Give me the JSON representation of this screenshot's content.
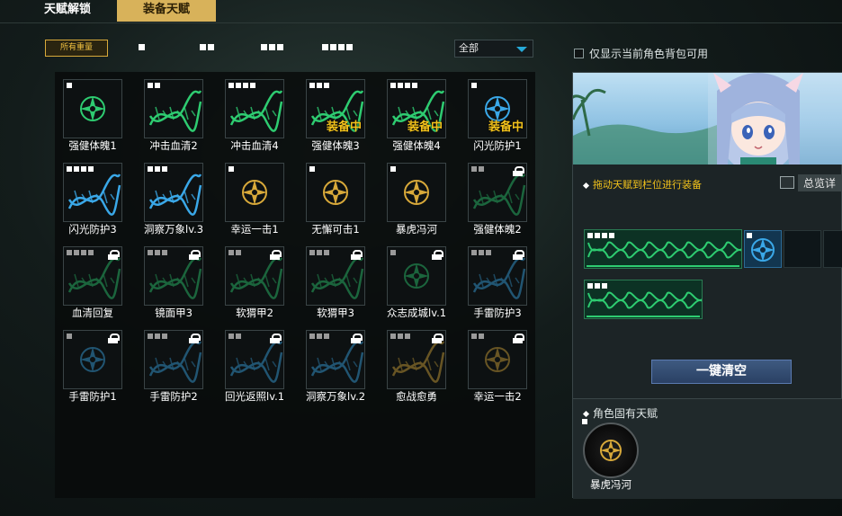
{
  "tabs": {
    "unlock": "天赋解锁",
    "equip": "装备天赋"
  },
  "filter": {
    "all_weight": "所有重量",
    "weight_levels": [
      1,
      2,
      3,
      4
    ],
    "dropdown_value": "全部"
  },
  "show_available_label": "仅显示当前角色背包可用",
  "equipped_text": "装备中",
  "talents": [
    {
      "name": "强健体魄1",
      "pips": 1,
      "locked": false,
      "equipped": false,
      "icon": "gear-badge-icon",
      "color": "#2ecc71"
    },
    {
      "name": "冲击血清2",
      "pips": 2,
      "locked": false,
      "equipped": false,
      "icon": "dna-chain-icon",
      "color": "#2ecc71"
    },
    {
      "name": "冲击血清4",
      "pips": 4,
      "locked": false,
      "equipped": false,
      "icon": "dna-chain-icon",
      "color": "#2ecc71"
    },
    {
      "name": "强健体魄3",
      "pips": 3,
      "locked": false,
      "equipped": true,
      "icon": "dna-chain-icon",
      "color": "#2ecc71"
    },
    {
      "name": "强健体魄4",
      "pips": 4,
      "locked": false,
      "equipped": true,
      "icon": "dna-chain-icon",
      "color": "#2ecc71"
    },
    {
      "name": "闪光防护1",
      "pips": 1,
      "locked": false,
      "equipped": true,
      "icon": "gear-badge-icon",
      "color": "#3aa8e8"
    },
    {
      "name": "闪光防护3",
      "pips": 4,
      "locked": false,
      "equipped": false,
      "icon": "dna-chain-icon",
      "color": "#3aa8e8"
    },
    {
      "name": "洞察万象lv.3",
      "pips": 3,
      "locked": false,
      "equipped": false,
      "icon": "dna-chain-icon",
      "color": "#3aa8e8"
    },
    {
      "name": "幸运一击1",
      "pips": 1,
      "locked": false,
      "equipped": false,
      "icon": "gear-badge-icon",
      "color": "#d8a93a"
    },
    {
      "name": "无懈可击1",
      "pips": 1,
      "locked": false,
      "equipped": false,
      "icon": "gear-badge-icon",
      "color": "#d8a93a"
    },
    {
      "name": "暴虎冯河",
      "pips": 1,
      "locked": false,
      "equipped": false,
      "icon": "gear-badge-icon",
      "color": "#d8a93a"
    },
    {
      "name": "强健体魄2",
      "pips": 2,
      "locked": true,
      "equipped": false,
      "icon": "dna-chain-icon",
      "color": "#2ecc71"
    },
    {
      "name": "血清回复",
      "pips": 4,
      "locked": true,
      "equipped": false,
      "icon": "dna-chain-icon",
      "color": "#2ecc71"
    },
    {
      "name": "镜面甲3",
      "pips": 3,
      "locked": true,
      "equipped": false,
      "icon": "dna-chain-icon",
      "color": "#2ecc71"
    },
    {
      "name": "软猬甲2",
      "pips": 2,
      "locked": true,
      "equipped": false,
      "icon": "dna-chain-icon",
      "color": "#2ecc71"
    },
    {
      "name": "软猬甲3",
      "pips": 3,
      "locked": true,
      "equipped": false,
      "icon": "dna-chain-icon",
      "color": "#2ecc71"
    },
    {
      "name": "众志成城lv.1",
      "pips": 1,
      "locked": true,
      "equipped": false,
      "icon": "gear-badge-icon",
      "color": "#2ecc71"
    },
    {
      "name": "手雷防护3",
      "pips": 3,
      "locked": true,
      "equipped": false,
      "icon": "dna-chain-icon",
      "color": "#3aa8e8"
    },
    {
      "name": "手雷防护1",
      "pips": 1,
      "locked": true,
      "equipped": false,
      "icon": "gear-badge-icon",
      "color": "#3aa8e8"
    },
    {
      "name": "手雷防护2",
      "pips": 3,
      "locked": true,
      "equipped": false,
      "icon": "dna-chain-icon",
      "color": "#3aa8e8"
    },
    {
      "name": "回光返照lv.1",
      "pips": 2,
      "locked": true,
      "equipped": false,
      "icon": "dna-chain-icon",
      "color": "#3aa8e8"
    },
    {
      "name": "洞察万象lv.2",
      "pips": 3,
      "locked": true,
      "equipped": false,
      "icon": "dna-chain-icon",
      "color": "#3aa8e8"
    },
    {
      "name": "愈战愈勇",
      "pips": 3,
      "locked": true,
      "equipped": false,
      "icon": "dna-chain-icon",
      "color": "#d8a93a"
    },
    {
      "name": "幸运一击2",
      "pips": 2,
      "locked": true,
      "equipped": false,
      "icon": "gear-badge-icon",
      "color": "#d8a93a"
    }
  ],
  "equip_panel": {
    "drag_hint": "拖动天赋到栏位进行装备",
    "overview_label": "总览详",
    "slot1_pips": 4,
    "slot2_pips": 3,
    "active_slot_pips": 1,
    "clear_button": "一键清空",
    "inherent_title": "角色固有天赋",
    "inherent_name": "暴虎冯河",
    "inherent_pips": 1
  },
  "colors": {
    "accent_gold": "#d8b25a",
    "equipped_yellow": "#f2c21b",
    "green": "#2ecc71",
    "blue": "#3aa8e8",
    "gold": "#d8a93a"
  }
}
